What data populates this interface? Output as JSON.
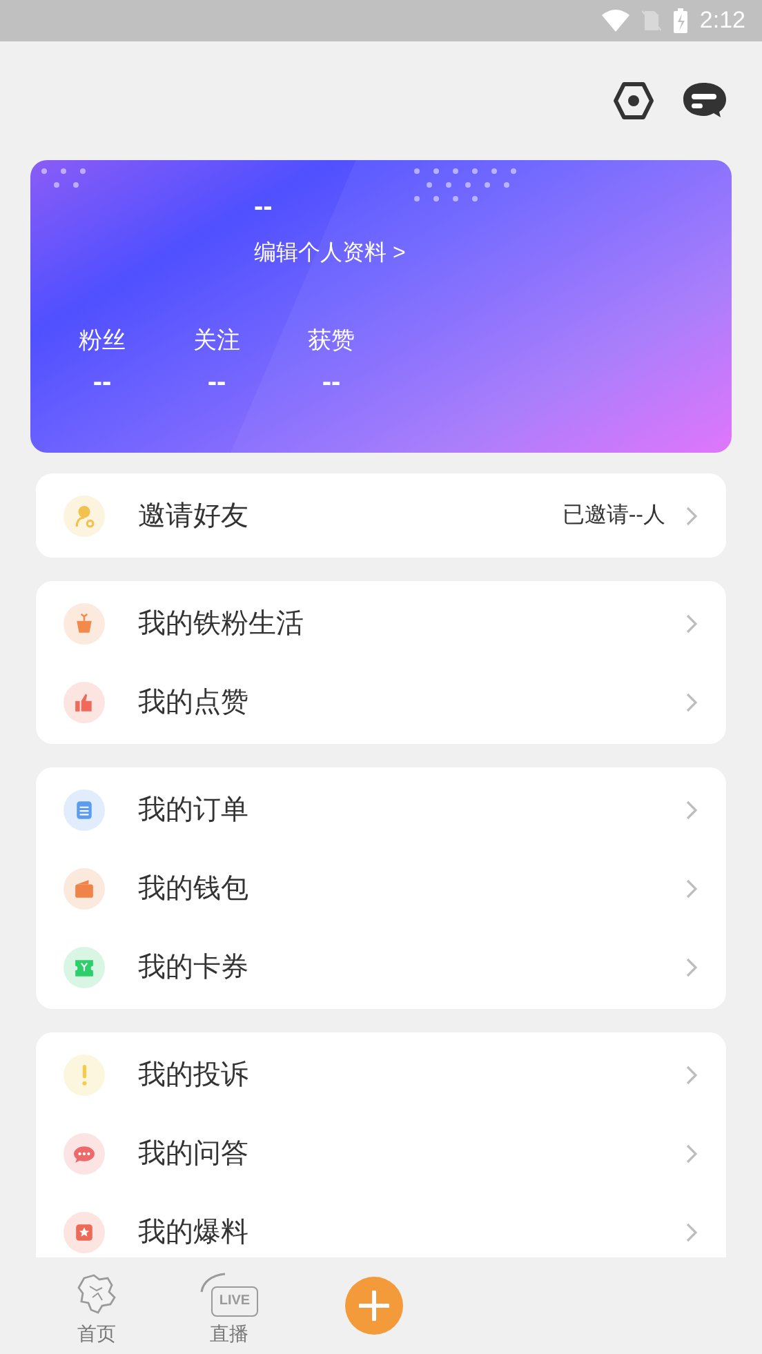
{
  "status_bar": {
    "time": "2:12"
  },
  "profile": {
    "name": "--",
    "edit_link": "编辑个人资料 >",
    "stats": [
      {
        "label": "粉丝",
        "value": "--"
      },
      {
        "label": "关注",
        "value": "--"
      },
      {
        "label": "获赞",
        "value": "--"
      }
    ]
  },
  "menu_groups": [
    [
      {
        "kind": "invite",
        "label": "邀请好友",
        "detail": "已邀请--人"
      }
    ],
    [
      {
        "kind": "gift",
        "label": "我的铁粉生活"
      },
      {
        "kind": "like",
        "label": "我的点赞"
      }
    ],
    [
      {
        "kind": "order",
        "label": "我的订单"
      },
      {
        "kind": "wallet",
        "label": "我的钱包"
      },
      {
        "kind": "coupon",
        "label": "我的卡券"
      }
    ],
    [
      {
        "kind": "complaint",
        "label": "我的投诉"
      },
      {
        "kind": "qa",
        "label": "我的问答"
      },
      {
        "kind": "report",
        "label": "我的爆料"
      }
    ]
  ],
  "tab_bar": [
    {
      "kind": "home",
      "label": "首页"
    },
    {
      "kind": "live",
      "label": "直播",
      "icon_text": "LIVE"
    },
    {
      "kind": "add"
    }
  ]
}
